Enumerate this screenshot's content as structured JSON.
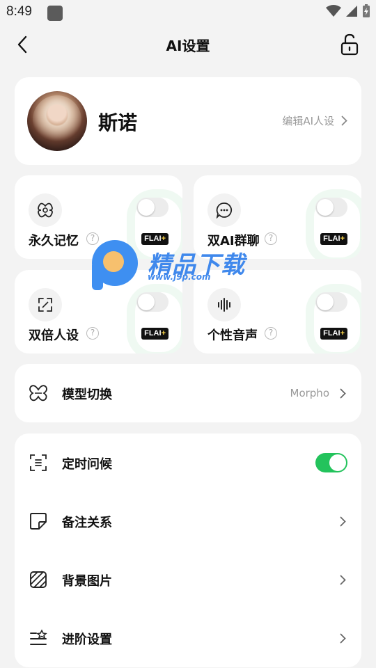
{
  "status_bar": {
    "time": "8:49"
  },
  "header": {
    "title": "AI设置"
  },
  "profile": {
    "name": "斯诺",
    "edit_label": "编辑AI人设"
  },
  "features": [
    {
      "label": "永久记忆",
      "badge": "FLAI",
      "badge_plus": "+",
      "enabled": false,
      "icon": "memory-icon"
    },
    {
      "label": "双AI群聊",
      "badge": "FLAI",
      "badge_plus": "+",
      "enabled": false,
      "icon": "chat-bubble-icon"
    },
    {
      "label": "双倍人设",
      "badge": "FLAI",
      "badge_plus": "+",
      "enabled": false,
      "icon": "expand-icon"
    },
    {
      "label": "个性音声",
      "badge": "FLAI",
      "badge_plus": "+",
      "enabled": false,
      "icon": "audio-wave-icon"
    }
  ],
  "model": {
    "label": "模型切换",
    "value": "Morpho"
  },
  "settings": [
    {
      "label": "定时问候",
      "toggle_on": true
    },
    {
      "label": "备注关系"
    },
    {
      "label": "背景图片"
    },
    {
      "label": "进阶设置"
    }
  ],
  "watermark": {
    "text": "精品下载",
    "url": "www.j9p.com"
  },
  "colors": {
    "accent_green": "#23c35c",
    "background": "#f3f3f3",
    "card": "#ffffff"
  }
}
